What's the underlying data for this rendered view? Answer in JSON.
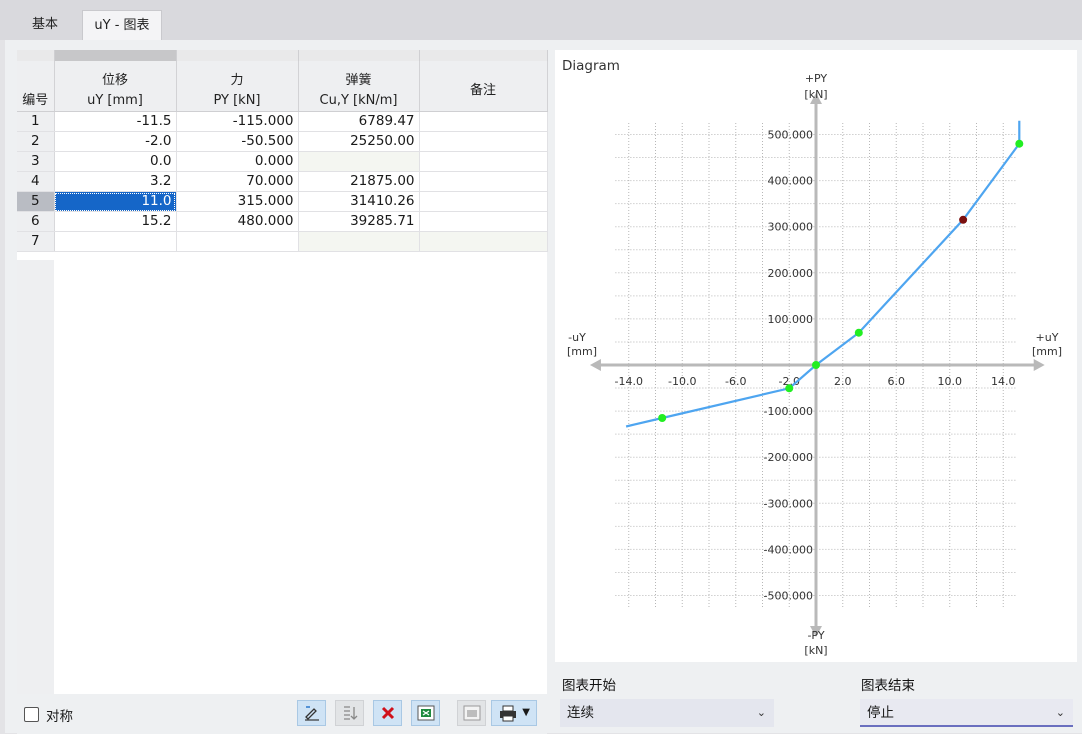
{
  "tabs": [
    {
      "label": "基本"
    },
    {
      "label": "uY - 图表"
    }
  ],
  "table": {
    "headers": {
      "rownum": "编号",
      "c1_top": "位移",
      "c1_bottom": "uY [mm]",
      "c2_top": "力",
      "c2_bottom": "PY [kN]",
      "c3_top": "弹簧",
      "c3_bottom": "Cu,Y [kN/m]",
      "c4": "备注"
    },
    "rows": [
      {
        "n": "1",
        "u": "-11.5",
        "p": "-115.000",
        "c": "6789.47",
        "note": ""
      },
      {
        "n": "2",
        "u": "-2.0",
        "p": "-50.500",
        "c": "25250.00",
        "note": ""
      },
      {
        "n": "3",
        "u": "0.0",
        "p": "0.000",
        "c": "",
        "note": ""
      },
      {
        "n": "4",
        "u": "3.2",
        "p": "70.000",
        "c": "21875.00",
        "note": ""
      },
      {
        "n": "5",
        "u": "11.0",
        "p": "315.000",
        "c": "31410.26",
        "note": ""
      },
      {
        "n": "6",
        "u": "15.2",
        "p": "480.000",
        "c": "39285.71",
        "note": ""
      },
      {
        "n": "7",
        "u": "",
        "p": "",
        "c": "",
        "note": ""
      }
    ],
    "selected_row": 5
  },
  "footer": {
    "symmetric_label": "对称",
    "symmetric_checked": false,
    "toolbar_icons": [
      "edit-icon",
      "sort-icon",
      "delete-icon",
      "excel-export-icon",
      "excel-import-icon",
      "print-icon"
    ]
  },
  "diagram": {
    "title": "Diagram",
    "y_pos_label": "+PY",
    "y_pos_unit": "[kN]",
    "y_neg_label": "-PY",
    "y_neg_unit": "[kN]",
    "x_pos_label": "+uY",
    "x_pos_unit": "[mm]",
    "x_neg_label": "-uY",
    "x_neg_unit": "[mm]",
    "x_ticks": [
      "-14.0",
      "-10.0",
      "-6.0",
      "-2.0",
      "2.0",
      "6.0",
      "10.0",
      "14.0"
    ],
    "y_ticks": [
      "500.000",
      "400.000",
      "300.000",
      "200.000",
      "100.000",
      "-100.000",
      "-200.000",
      "-300.000",
      "-400.000",
      "-500.000"
    ],
    "line_color": "#4ea5f0",
    "point_color": "#22ee22",
    "selected_point_color": "#7a1010"
  },
  "chart_data": {
    "type": "line",
    "x": [
      -11.5,
      -2.0,
      0.0,
      3.2,
      11.0,
      15.2
    ],
    "y": [
      -115.0,
      -50.5,
      0.0,
      70.0,
      315.0,
      480.0
    ],
    "selected_index": 4,
    "xlim": [
      -16,
      16
    ],
    "ylim": [
      -590,
      590
    ],
    "grid": true
  },
  "start_select": {
    "label": "图表开始",
    "value": "连续"
  },
  "end_select": {
    "label": "图表结束",
    "value": "停止"
  }
}
